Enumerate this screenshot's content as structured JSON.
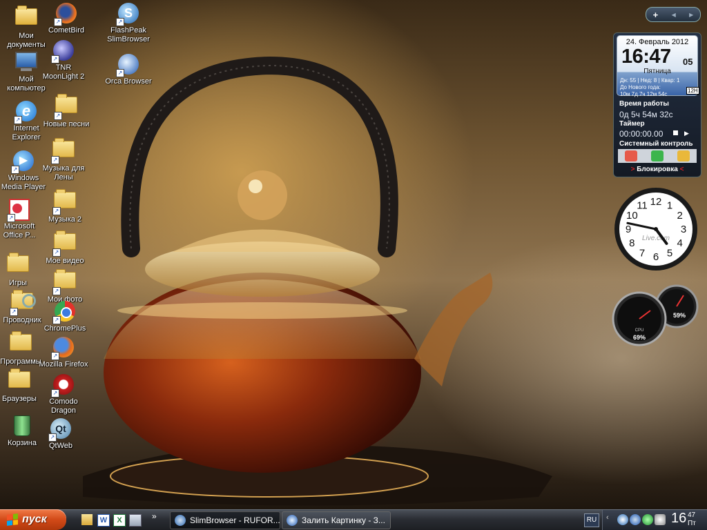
{
  "desktop": {
    "col1": [
      {
        "label": "Мои документы",
        "icon": "my-documents-icon"
      },
      {
        "label": "Мой компьютер",
        "icon": "my-computer-icon"
      },
      {
        "label": "Internet Explorer",
        "icon": "internet-explorer-icon"
      },
      {
        "label": "Windows Media Player",
        "icon": "windows-media-player-icon"
      },
      {
        "label": "Microsoft Office P...",
        "icon": "office-powerpoint-icon"
      },
      {
        "label": "Игры",
        "icon": "folder-icon"
      },
      {
        "label": "Проводник",
        "icon": "explorer-icon"
      },
      {
        "label": "Программы",
        "icon": "folder-icon"
      },
      {
        "label": "Браузеры",
        "icon": "folder-icon"
      },
      {
        "label": "Корзина",
        "icon": "recycle-bin-icon"
      }
    ],
    "col2": [
      {
        "label": "CometBird",
        "icon": "cometbird-icon"
      },
      {
        "label": "TNR MoonLight 2",
        "icon": "moonlight-icon"
      },
      {
        "label": "Новые песни",
        "icon": "folder-icon"
      },
      {
        "label": "Музыка для Лены",
        "icon": "folder-icon"
      },
      {
        "label": "Музыка 2",
        "icon": "folder-icon"
      },
      {
        "label": "Мое видео",
        "icon": "folder-icon"
      },
      {
        "label": "Мои фото",
        "icon": "folder-icon"
      },
      {
        "label": "ChromePlus",
        "icon": "chromeplus-icon"
      },
      {
        "label": "Mozilla Firefox",
        "icon": "firefox-icon"
      },
      {
        "label": "Comodo Dragon",
        "icon": "comodo-dragon-icon"
      },
      {
        "label": "QtWeb",
        "icon": "qtweb-icon"
      }
    ],
    "col3": [
      {
        "label": "FlashPeak SlimBrowser",
        "icon": "slimbrowser-icon"
      },
      {
        "label": "Orca Browser",
        "icon": "orca-browser-icon"
      }
    ]
  },
  "sidebar_nav": {
    "add": "+",
    "prev": "◀",
    "next": "▶"
  },
  "clock_gadget": {
    "date": "24. Февраль 2012",
    "time": "16:47",
    "seconds": "05",
    "weekday": "Пятница",
    "stats": "Дн: 55 |  Нед: 8 |  Квар: 1",
    "new_year_label": "До Нового года:",
    "new_year_value": "10м 7д   7ч  12м  54с",
    "mode": "12H",
    "uptime_label": "Время работы",
    "uptime_value": "0д 5ч 54м 32с",
    "timer_label": "Таймер",
    "timer_value": "00:00:00.00",
    "system_label": "Системный контроль",
    "lock_label": "Блокировка"
  },
  "analog_clock": {
    "brand": "Live.com",
    "hour": 4,
    "minute": 47,
    "numerals": [
      "12",
      "1",
      "2",
      "3",
      "4",
      "5",
      "6",
      "7",
      "8",
      "9",
      "10",
      "11"
    ]
  },
  "meters": {
    "cpu_label": "CPU",
    "cpu_percent": "69%",
    "mem_percent": "59%",
    "cpu_value": 69,
    "mem_value": 59
  },
  "taskbar": {
    "start_label": "пуск",
    "quicklaunch_more": "»",
    "tasks": [
      {
        "label": "SlimBrowser - RUFOR...",
        "icon": "slimbrowser-icon",
        "active": true
      },
      {
        "label": "Залить Картинку - З...",
        "icon": "orca-browser-icon",
        "active": false
      }
    ],
    "language": "RU",
    "clock_hour": "16",
    "clock_min": "47",
    "clock_day": "Пт"
  },
  "colors": {
    "start": "#d24a18",
    "taskbar": "#2a2d33",
    "gadget_bg": "#141a24"
  }
}
